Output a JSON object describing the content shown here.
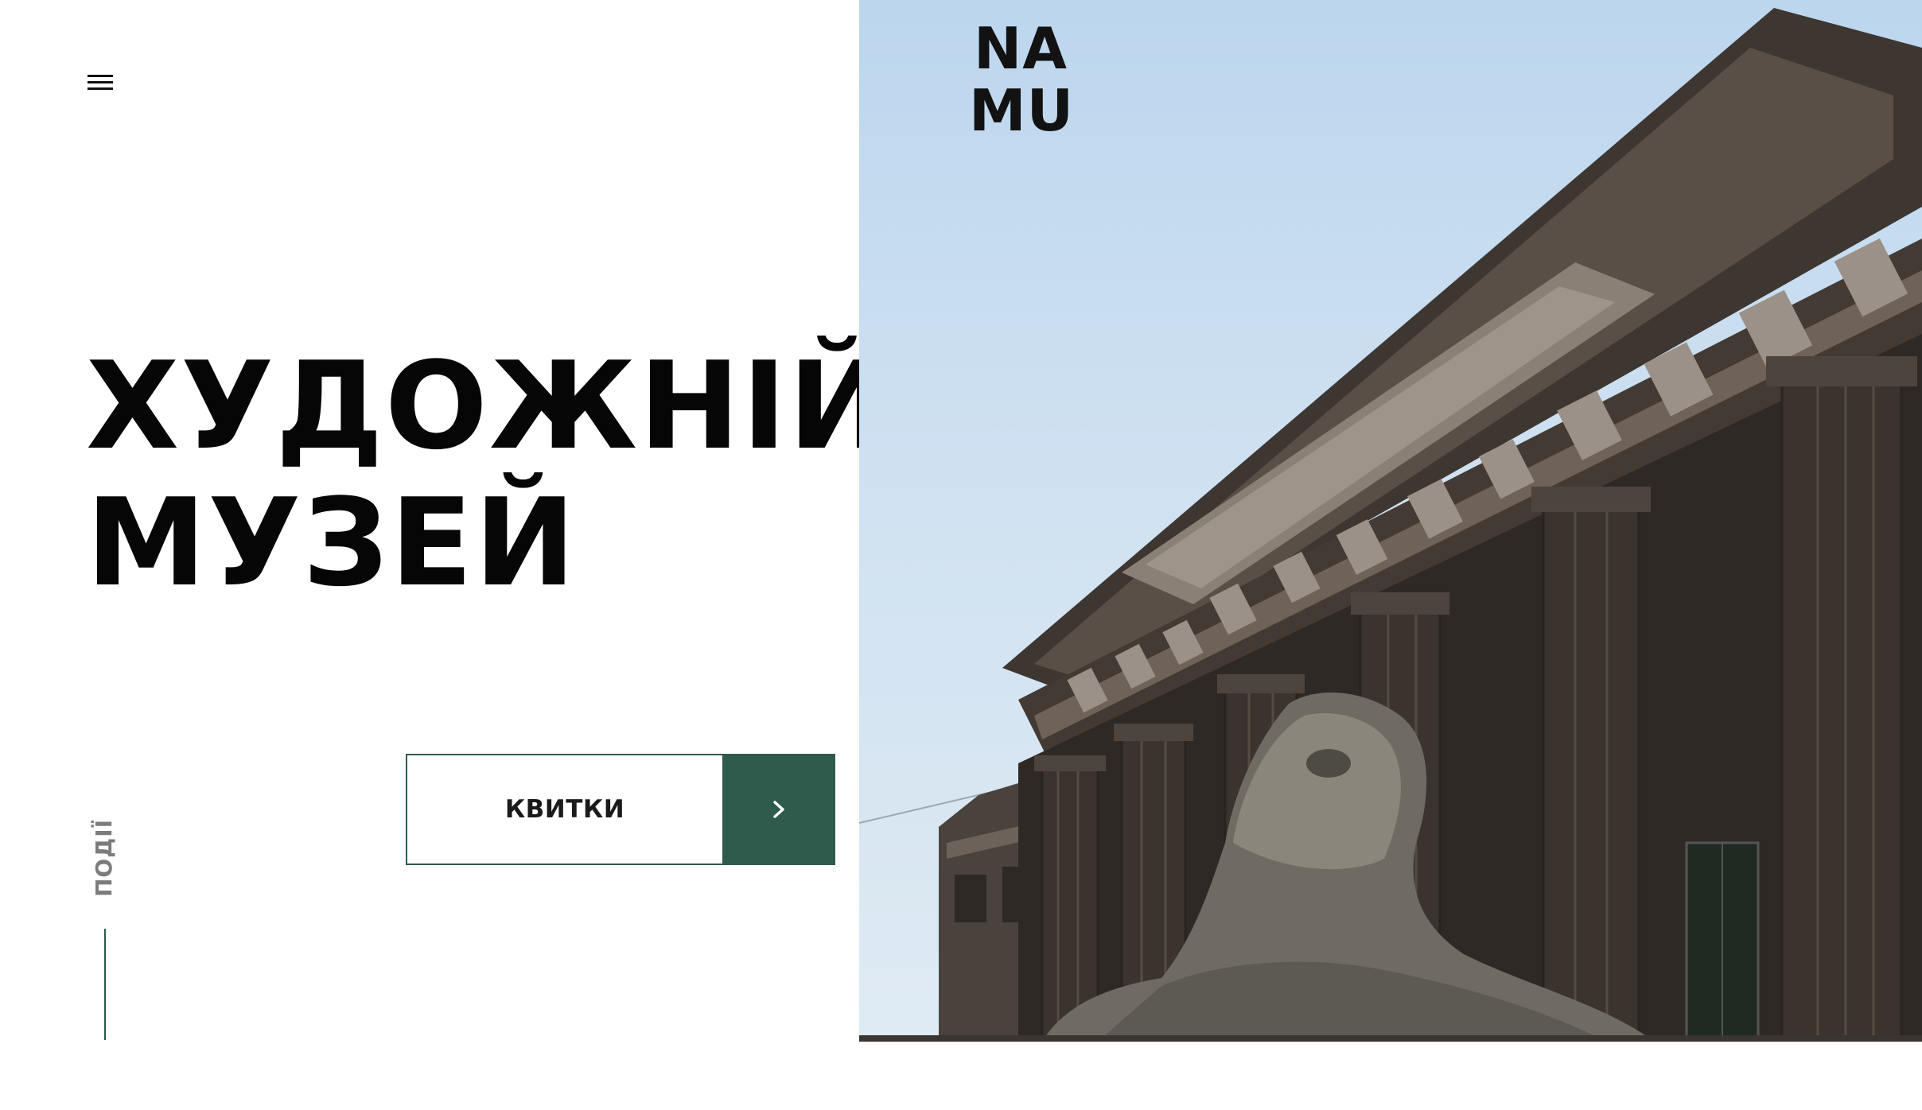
{
  "header": {
    "menu_icon": "hamburger-menu-icon",
    "logo": {
      "line1": "NA",
      "line2": "MU"
    }
  },
  "hero": {
    "title_line1": "ХУДОЖНІЙ",
    "title_line2": "МУЗЕЙ",
    "image_subject": "museum-building-facade-with-lion-sculpture"
  },
  "side_nav": {
    "events_label": "ПОДІЇ"
  },
  "cta": {
    "tickets_label": "КВИТКИ",
    "arrow_icon": "chevron-right-icon"
  },
  "colors": {
    "accent": "#2e5b4b",
    "text": "#060606",
    "muted": "#7c7c7c",
    "background": "#ffffff"
  }
}
